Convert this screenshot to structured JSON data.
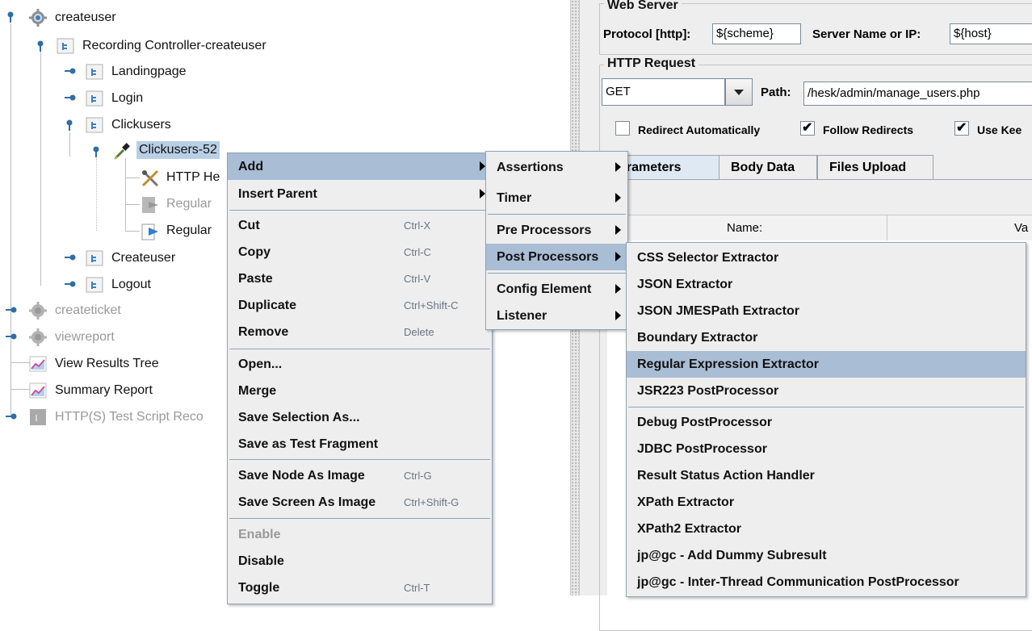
{
  "tree": {
    "nodes": [
      {
        "label": "createuser",
        "icon": "gear-icon"
      },
      {
        "label": "Recording Controller-createuser",
        "icon": "controller-icon"
      },
      {
        "label": "Landingpage",
        "icon": "controller-icon"
      },
      {
        "label": "Login",
        "icon": "controller-icon"
      },
      {
        "label": "Clickusers",
        "icon": "controller-icon"
      },
      {
        "label": "Clickusers-52",
        "icon": "sampler-pipette-icon"
      },
      {
        "label": "HTTP He",
        "icon": "http-header-icon"
      },
      {
        "label": "Regular",
        "icon": "regex-disabled-icon"
      },
      {
        "label": "Regular",
        "icon": "regex-extractor-icon"
      },
      {
        "label": "Createuser",
        "icon": "controller-icon"
      },
      {
        "label": "Logout",
        "icon": "controller-icon"
      },
      {
        "label": "createticket",
        "icon": "gear-disabled-icon"
      },
      {
        "label": "viewreport",
        "icon": "gear-disabled-icon"
      },
      {
        "label": "View Results Tree",
        "icon": "listener-chart-icon"
      },
      {
        "label": "Summary Report",
        "icon": "listener-chart-icon"
      },
      {
        "label": "HTTP(S) Test Script Reco",
        "icon": "recorder-disabled-icon"
      }
    ]
  },
  "webserver": {
    "title": "Web Server",
    "protocol_label": "Protocol [http]:",
    "protocol_value": "${scheme}",
    "server_label": "Server Name or IP:",
    "server_value": "${host}"
  },
  "httprequest": {
    "title": "HTTP Request",
    "method": "GET",
    "path_label": "Path:",
    "path_value": "/hesk/admin/manage_users.php",
    "redirect_auto": "Redirect Automatically",
    "follow_redirects": "Follow Redirects",
    "use_keepalive": "Use Kee",
    "tabs": [
      "arameters",
      "Body Data",
      "Files Upload"
    ],
    "col_name": "Name:",
    "col_value": "Va"
  },
  "context_menu": {
    "items": [
      {
        "label": "Add",
        "shortcut": "",
        "submenu": true
      },
      {
        "label": "Insert Parent",
        "shortcut": "",
        "submenu": true
      },
      {
        "label": "Cut",
        "shortcut": "Ctrl-X"
      },
      {
        "label": "Copy",
        "shortcut": "Ctrl-C"
      },
      {
        "label": "Paste",
        "shortcut": "Ctrl-V"
      },
      {
        "label": "Duplicate",
        "shortcut": "Ctrl+Shift-C"
      },
      {
        "label": "Remove",
        "shortcut": "Delete"
      },
      {
        "label": "Open...",
        "shortcut": ""
      },
      {
        "label": "Merge",
        "shortcut": ""
      },
      {
        "label": "Save Selection As...",
        "shortcut": ""
      },
      {
        "label": "Save as Test Fragment",
        "shortcut": ""
      },
      {
        "label": "Save Node As Image",
        "shortcut": "Ctrl-G"
      },
      {
        "label": "Save Screen As Image",
        "shortcut": "Ctrl+Shift-G"
      },
      {
        "label": "Enable",
        "shortcut": ""
      },
      {
        "label": "Disable",
        "shortcut": ""
      },
      {
        "label": "Toggle",
        "shortcut": "Ctrl-T"
      }
    ]
  },
  "add_menu": {
    "items": [
      "Assertions",
      "Timer",
      "Pre Processors",
      "Post Processors",
      "Config Element",
      "Listener"
    ]
  },
  "post_menu": {
    "items": [
      "CSS Selector Extractor",
      "JSON Extractor",
      "JSON JMESPath Extractor",
      "Boundary Extractor",
      "Regular Expression Extractor",
      "JSR223 PostProcessor",
      "Debug PostProcessor",
      "JDBC PostProcessor",
      "Result Status Action Handler",
      "XPath Extractor",
      "XPath2 Extractor",
      "jp@gc - Add Dummy Subresult",
      "jp@gc - Inter-Thread Communication PostProcessor"
    ]
  },
  "colors": {
    "highlight": "#a9bdd4",
    "selection": "#b8cfe5",
    "menu_bg": "#eeeeee"
  }
}
